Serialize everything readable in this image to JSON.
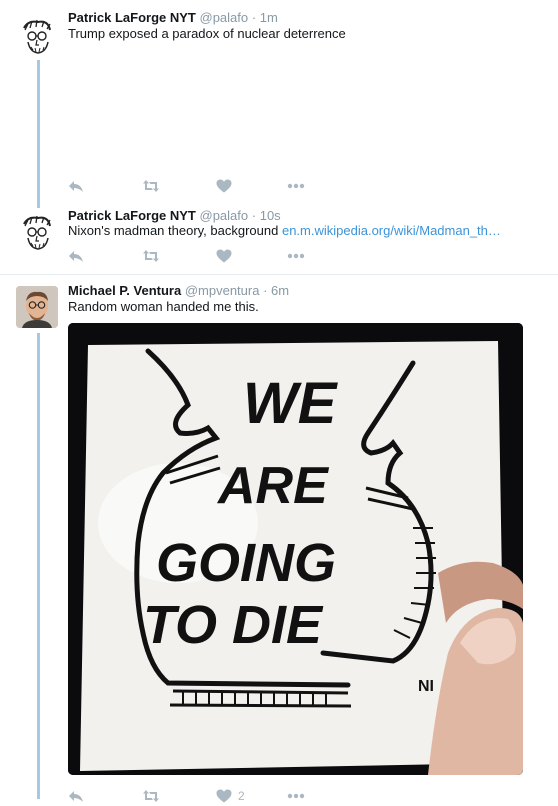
{
  "tweets": [
    {
      "name": "Patrick LaForge NYT",
      "handle": "@palafo",
      "dot": "·",
      "time": "1m",
      "text": "Trump exposed a  paradox of nuclear deterrence",
      "link": ""
    },
    {
      "name": "Patrick LaForge NYT",
      "handle": "@palafo",
      "dot": "·",
      "time": "10s",
      "text": "Nixon's madman theory, background ",
      "link": "en.m.wikipedia.org/wiki/Madman_th…"
    },
    {
      "name": "Michael P. Ventura",
      "handle": "@mpventura",
      "dot": "·",
      "time": "6m",
      "text": "Random woman handed me this.",
      "link": "",
      "like_count": "2"
    }
  ],
  "sticker": {
    "lines": [
      "WE",
      "ARE",
      "GOING",
      "TO DIE"
    ],
    "signature": "NI"
  },
  "icons": [
    "reply-icon",
    "retweet-icon",
    "like-icon",
    "more-icon"
  ],
  "colors": {
    "thread_line": "#a6c8e3",
    "link": "#3b94d9",
    "muted": "#8899a6",
    "action_icon": "#aab8c2"
  }
}
